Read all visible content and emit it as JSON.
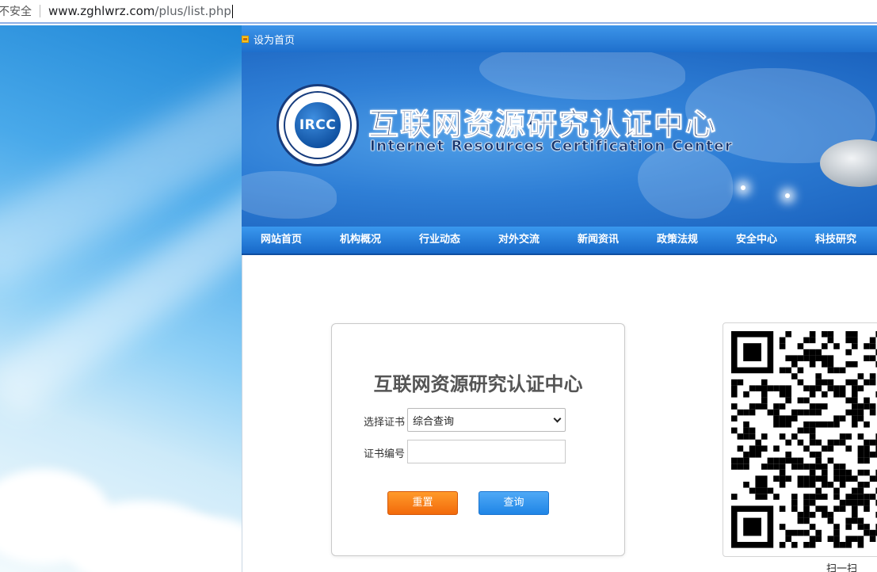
{
  "browser": {
    "security_label": "不安全",
    "url_host": "www.zghlwrz.com",
    "url_path": "/plus/list.php"
  },
  "header": {
    "set_homepage": "设为首页",
    "logo_text": "IRCC",
    "title_cn": "互联网资源研究认证中心",
    "title_en": "Internet Resources Certification Center"
  },
  "nav": {
    "items": [
      "网站首页",
      "机构概况",
      "行业动态",
      "对外交流",
      "新闻资讯",
      "政策法规",
      "安全中心",
      "科技研究"
    ]
  },
  "query": {
    "heading": "互联网资源研究认证中心",
    "cert_type_label": "选择证书",
    "cert_type_value": "综合查询",
    "cert_no_label": "证书编号",
    "cert_no_value": "",
    "reset_label": "重置",
    "search_label": "查询"
  },
  "qr": {
    "caption": "扫一扫"
  },
  "colors": {
    "nav_blue": "#1e6fcc",
    "reset_orange": "#f26a0b",
    "search_blue": "#1f85e6"
  }
}
